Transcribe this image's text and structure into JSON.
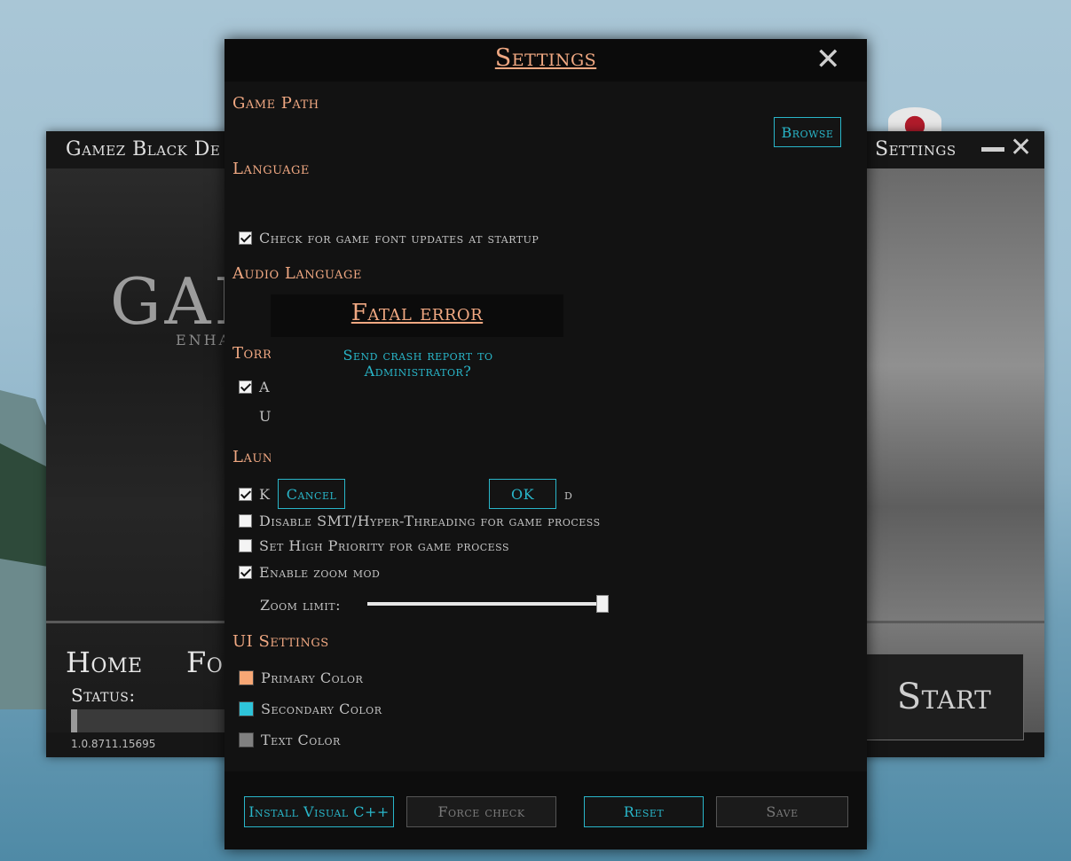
{
  "launcher": {
    "title": "Gamez Black De",
    "logo": "GAM",
    "logo_sub": "ENHA",
    "settings_label": "Settings",
    "nav_home": "Home",
    "nav_fo": "Fo",
    "status_label": "Status:",
    "progress": 0.04,
    "version": "1.0.8711.15695",
    "start_label": "Start"
  },
  "settings": {
    "title": "Settings",
    "sections": {
      "game_path": "Game Path",
      "language": "Language",
      "audio_language": "Audio Language",
      "torrent": "Torr",
      "launch": "Laun",
      "ui_settings": "UI Settings"
    },
    "browse_label": "Browse",
    "check_font_updates": "Check for game font updates at startup",
    "torrent_opt_a": "A",
    "torrent_opt_u": "U",
    "launch_opt_k": "K",
    "launch_opt_d_tail": "d",
    "disable_smt": "Disable SMT/Hyper-Threading for game process",
    "high_priority": "Set High Priority for game process",
    "enable_zoom": "Enable zoom mod",
    "zoom_label": "Zoom limit:",
    "zoom_value": 1.0,
    "primary_color_label": "Primary Color",
    "secondary_color_label": "Secondary Color",
    "text_color_label": "Text Color",
    "colors": {
      "primary": "#f7a775",
      "secondary": "#2ec4d9",
      "text": "#808080"
    },
    "install_vc_label": "Install Visual C++",
    "force_check_label": "Force check",
    "reset_label": "Reset",
    "save_label": "Save"
  },
  "error": {
    "title": "Fatal error",
    "message": "Send crash report to Administrator?",
    "cancel_label": "Cancel",
    "ok_label": "OK"
  }
}
